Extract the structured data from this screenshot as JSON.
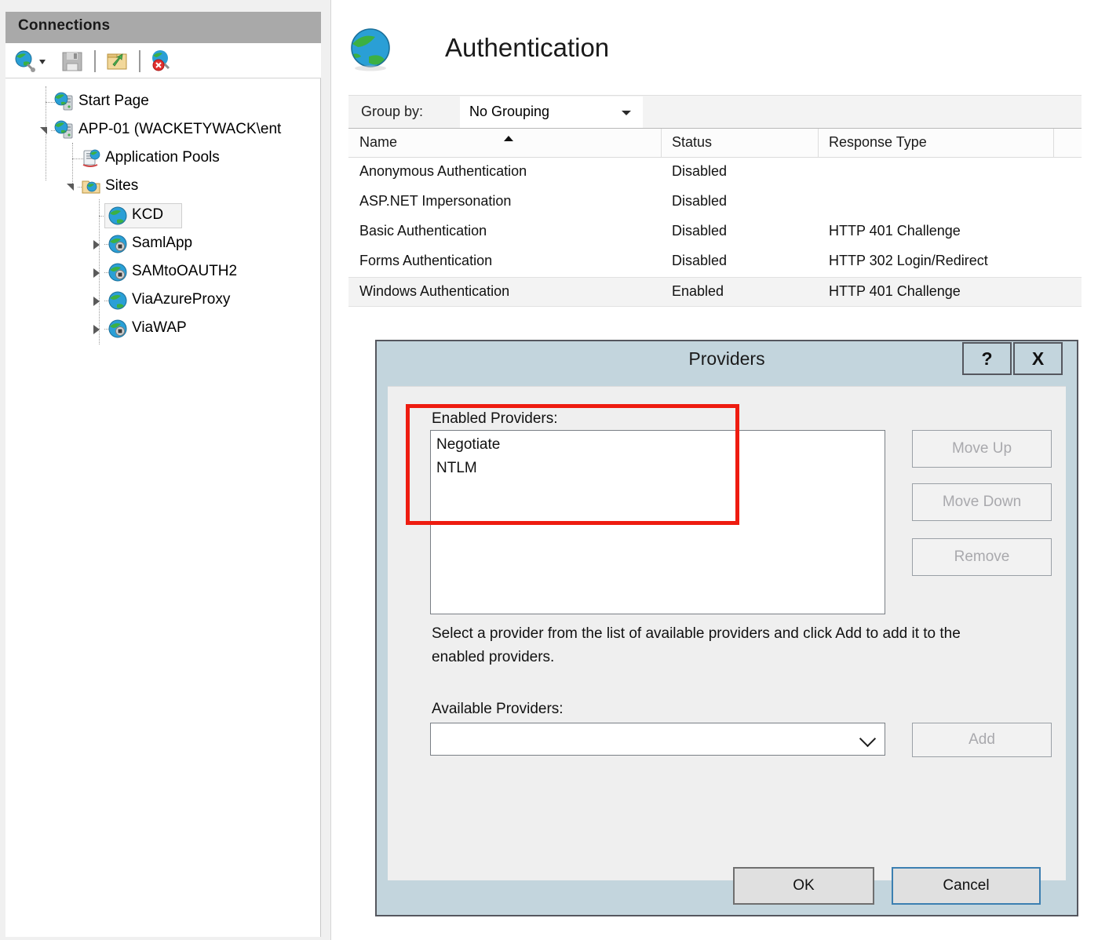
{
  "connections": {
    "header_title": "Connections",
    "toolbar": [
      {
        "name": "connect-to-server-icon",
        "glyph": "globe-plug"
      },
      {
        "name": "save-connections-icon",
        "glyph": "floppy-disk"
      },
      {
        "name": "connect-to-site-icon",
        "glyph": "folder-arrow"
      },
      {
        "name": "disconnect-icon",
        "glyph": "globe-disconnect"
      }
    ],
    "tree": [
      {
        "label": "Start Page",
        "icon": "server-globe-icon",
        "depth": 0,
        "twisty": "none",
        "selected": false
      },
      {
        "label": "APP-01 (WACKETYWACK\\ent",
        "icon": "server-globe-icon",
        "depth": 0,
        "twisty": "expanded",
        "selected": false
      },
      {
        "label": "Application Pools",
        "icon": "application-pools-icon",
        "depth": 1,
        "twisty": "none",
        "selected": false
      },
      {
        "label": "Sites",
        "icon": "sites-folder-icon",
        "depth": 1,
        "twisty": "expanded",
        "selected": false
      },
      {
        "label": "KCD",
        "icon": "site-globe-icon",
        "depth": 2,
        "twisty": "none",
        "selected": true
      },
      {
        "label": "SamlApp",
        "icon": "app-globe-icon",
        "depth": 2,
        "twisty": "collapsed",
        "selected": false
      },
      {
        "label": "SAMtoOAUTH2",
        "icon": "app-globe-icon",
        "depth": 2,
        "twisty": "collapsed",
        "selected": false
      },
      {
        "label": "ViaAzureProxy",
        "icon": "site-globe-icon",
        "depth": 2,
        "twisty": "collapsed",
        "selected": false
      },
      {
        "label": "ViaWAP",
        "icon": "app-globe-icon",
        "depth": 2,
        "twisty": "collapsed",
        "selected": false
      }
    ]
  },
  "main": {
    "page_title": "Authentication",
    "page_icon": "authentication-globe-icon",
    "group_by_label": "Group by:",
    "group_by_value": "No Grouping",
    "table": {
      "columns": [
        "Name",
        "Status",
        "Response Type"
      ],
      "sort_column": "Name",
      "sort_direction": "ascending",
      "rows": [
        {
          "name": "Anonymous Authentication",
          "status": "Disabled",
          "response_type": "",
          "selected": false
        },
        {
          "name": "ASP.NET Impersonation",
          "status": "Disabled",
          "response_type": "",
          "selected": false
        },
        {
          "name": "Basic Authentication",
          "status": "Disabled",
          "response_type": "HTTP 401 Challenge",
          "selected": false
        },
        {
          "name": "Forms Authentication",
          "status": "Disabled",
          "response_type": "HTTP 302 Login/Redirect",
          "selected": false
        },
        {
          "name": "Windows Authentication",
          "status": "Enabled",
          "response_type": "HTTP 401 Challenge",
          "selected": true
        }
      ]
    }
  },
  "dialog": {
    "title": "Providers",
    "help_label": "?",
    "close_label": "X",
    "enabled_providers_label": "Enabled Providers:",
    "enabled_providers": [
      "Negotiate",
      "NTLM"
    ],
    "side_buttons": [
      {
        "label": "Move Up",
        "enabled": false
      },
      {
        "label": "Move Down",
        "enabled": false
      },
      {
        "label": "Remove",
        "enabled": false
      }
    ],
    "hint_text": "Select a provider from the list of available providers and click Add to add it to the enabled providers.",
    "available_providers_label": "Available Providers:",
    "available_providers_value": "",
    "add_label": "Add",
    "add_enabled": false,
    "ok_label": "OK",
    "cancel_label": "Cancel"
  },
  "annotation": {
    "highlight_color": "#ee1c10",
    "target": "enabled-providers-list"
  }
}
